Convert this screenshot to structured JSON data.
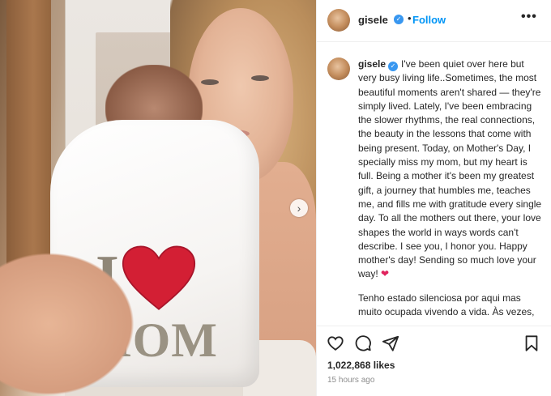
{
  "header": {
    "username": "gisele",
    "separator": "•",
    "follow_label": "Follow",
    "more_label": "•••"
  },
  "caption": {
    "username": "gisele",
    "paragraph_1": "I've been quiet over here but very busy living life..Sometimes, the most beautiful moments aren't shared — they're simply lived. Lately, I've been embracing the slower rhythms, the real connections, the beauty in the lessons that come with being present. Today, on Mother's Day, I specially miss my mom, but my heart is full. Being a mother it's been my greatest gift, a journey that humbles me, teaches me, and fills me with gratitude every single day. To all the mothers out there, your love shapes the world in ways words can't describe. I see you, I honor you. Happy mother's day! Sending so much love your way!",
    "heart_emoji": "❤",
    "paragraph_2": "Tenho estado silenciosa por aqui mas muito ocupada vivendo a vida. Às vezes, os momentos mais lindos não são compartilhados, são simplesmente"
  },
  "photo": {
    "onesie_letter": "I",
    "onesie_word": "MOM",
    "carousel_next": "›"
  },
  "stats": {
    "likes": "1,022,868 likes",
    "time": "15 hours ago"
  },
  "icons": {
    "like": "heart-outline-icon",
    "comment": "comment-bubble-icon",
    "share": "paper-plane-icon",
    "save": "bookmark-icon",
    "verified": "verified-badge-icon"
  },
  "colors": {
    "follow": "#0095f6",
    "verified": "#3897f0",
    "heart": "#e0245e",
    "onesie_heart": "#d31f34"
  }
}
